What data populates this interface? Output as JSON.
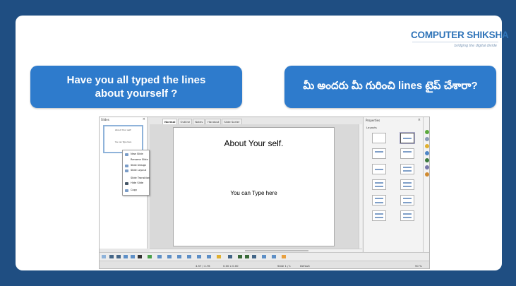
{
  "logo": {
    "main": "COMPUTER SHIKSHA",
    "tagline": "bridging the digital divide"
  },
  "bubbles": {
    "english": "Have you all typed the lines about yourself ?",
    "telugu": "మీ అందరు మీ గురించి lines టైప్ చేశారా?"
  },
  "impress": {
    "slides_pane_title": "Slides",
    "close_glyph": "×",
    "thumbnail": {
      "title": "About Your self.",
      "body": "You can Type here"
    },
    "tabs": [
      "Normal",
      "Outline",
      "Notes",
      "Handout",
      "Slide Sorter"
    ],
    "slide": {
      "title": "About Your self.",
      "body": "You can Type here"
    },
    "context_menu": [
      "New Slide",
      "Rename Slide",
      "Slide Design",
      "Slide Layout",
      "Slide Transition",
      "Hide Slide",
      "Copy"
    ],
    "properties": {
      "title": "Properties",
      "layouts_label": "Layouts"
    },
    "status": {
      "position": "4.57 / 4.76",
      "size": "0.00 x 0.00",
      "slide": "Slide 1 / 1",
      "master": "Default",
      "zoom": "50 %"
    }
  }
}
